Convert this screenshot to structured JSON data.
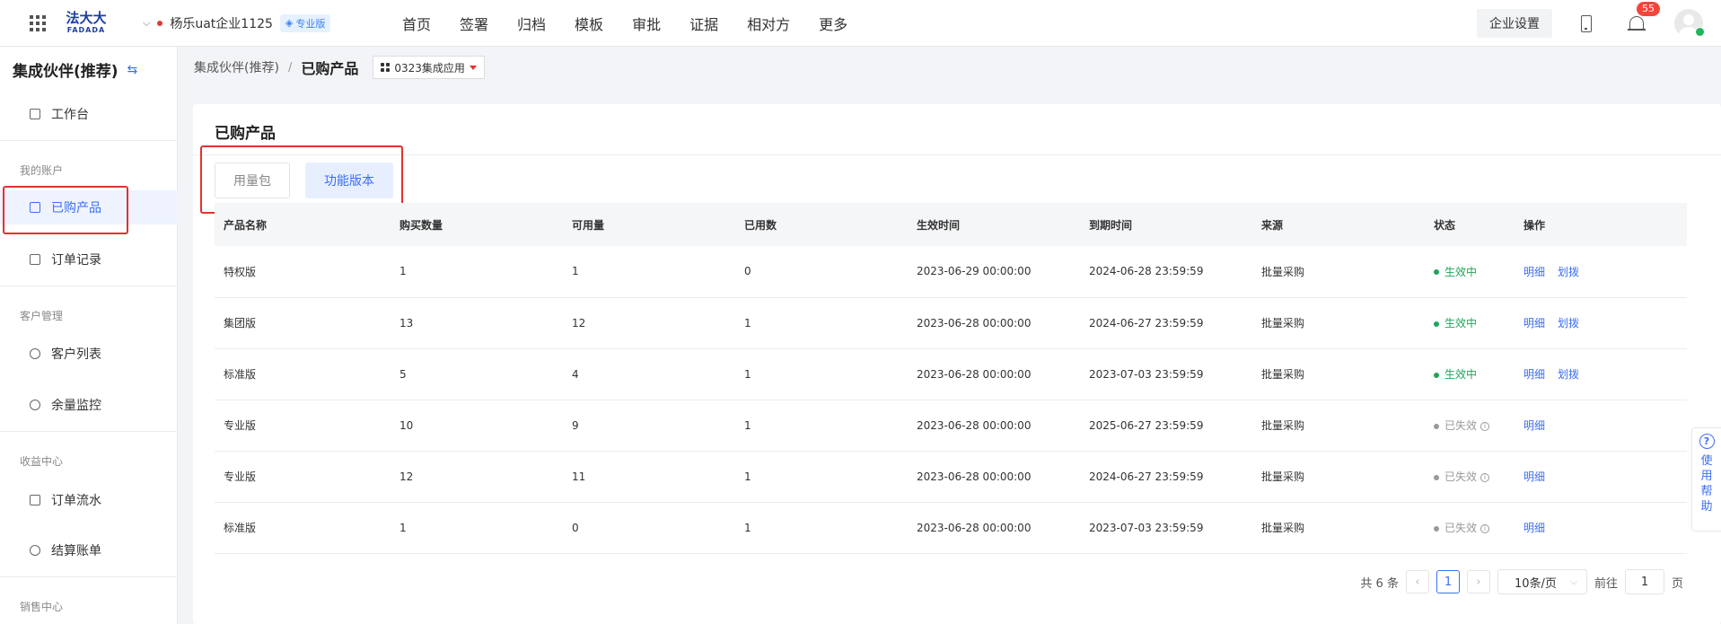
{
  "topbar": {
    "logo_cn": "法大大",
    "logo_en": "FADADA",
    "company_name": "杨乐uat企业1125",
    "edition": "专业版",
    "nav": [
      "首页",
      "签署",
      "归档",
      "模板",
      "审批",
      "证据",
      "相对方",
      "更多"
    ],
    "settings_label": "企业设置",
    "notification_count": "55"
  },
  "sidebar": {
    "title": "集成伙伴(推荐)",
    "workbench": "工作台",
    "group_account": "我的账户",
    "purchased": "已购产品",
    "orders": "订单记录",
    "group_customer": "客户管理",
    "customer_list": "客户列表",
    "balance_monitor": "余量监控",
    "group_revenue": "收益中心",
    "order_flow": "订单流水",
    "settlement": "结算账单",
    "group_sales": "销售中心"
  },
  "breadcrumb": {
    "parent": "集成伙伴(推荐)",
    "current": "已购产品",
    "app": "0323集成应用"
  },
  "card": {
    "title": "已购产品",
    "tab_usage": "用量包",
    "tab_feature": "功能版本"
  },
  "table": {
    "headers": [
      "产品名称",
      "购买数量",
      "可用量",
      "已用数",
      "生效时间",
      "到期时间",
      "来源",
      "状态",
      "操作"
    ],
    "rows": [
      {
        "name": "特权版",
        "qty": "1",
        "avail": "1",
        "used": "0",
        "start": "2023-06-29 00:00:00",
        "end": "2024-06-28 23:59:59",
        "source": "批量采购",
        "status": "生效中",
        "active": true,
        "op1": "明细",
        "op2": "划拨"
      },
      {
        "name": "集团版",
        "qty": "13",
        "avail": "12",
        "used": "1",
        "start": "2023-06-28 00:00:00",
        "end": "2024-06-27 23:59:59",
        "source": "批量采购",
        "status": "生效中",
        "active": true,
        "op1": "明细",
        "op2": "划拨"
      },
      {
        "name": "标准版",
        "qty": "5",
        "avail": "4",
        "used": "1",
        "start": "2023-06-28 00:00:00",
        "end": "2023-07-03 23:59:59",
        "source": "批量采购",
        "status": "生效中",
        "active": true,
        "op1": "明细",
        "op2": "划拨"
      },
      {
        "name": "专业版",
        "qty": "10",
        "avail": "9",
        "used": "1",
        "start": "2023-06-28 00:00:00",
        "end": "2025-06-27 23:59:59",
        "source": "批量采购",
        "status": "已失效",
        "active": false,
        "op1": "明细",
        "op2": ""
      },
      {
        "name": "专业版",
        "qty": "12",
        "avail": "11",
        "used": "1",
        "start": "2023-06-28 00:00:00",
        "end": "2024-06-27 23:59:59",
        "source": "批量采购",
        "status": "已失效",
        "active": false,
        "op1": "明细",
        "op2": ""
      },
      {
        "name": "标准版",
        "qty": "1",
        "avail": "0",
        "used": "1",
        "start": "2023-06-28 00:00:00",
        "end": "2023-07-03 23:59:59",
        "source": "批量采购",
        "status": "已失效",
        "active": false,
        "op1": "明细",
        "op2": ""
      }
    ]
  },
  "pagination": {
    "total": "共 6 条",
    "current_page": "1",
    "page_size": "10条/页",
    "goto_label": "前往",
    "goto_value": "1",
    "page_suffix": "页"
  },
  "help": {
    "label": "使用帮助"
  },
  "colors": {
    "accent": "#3b6ef5",
    "active_status": "#1fa55a",
    "highlight_box": "#e53030"
  }
}
